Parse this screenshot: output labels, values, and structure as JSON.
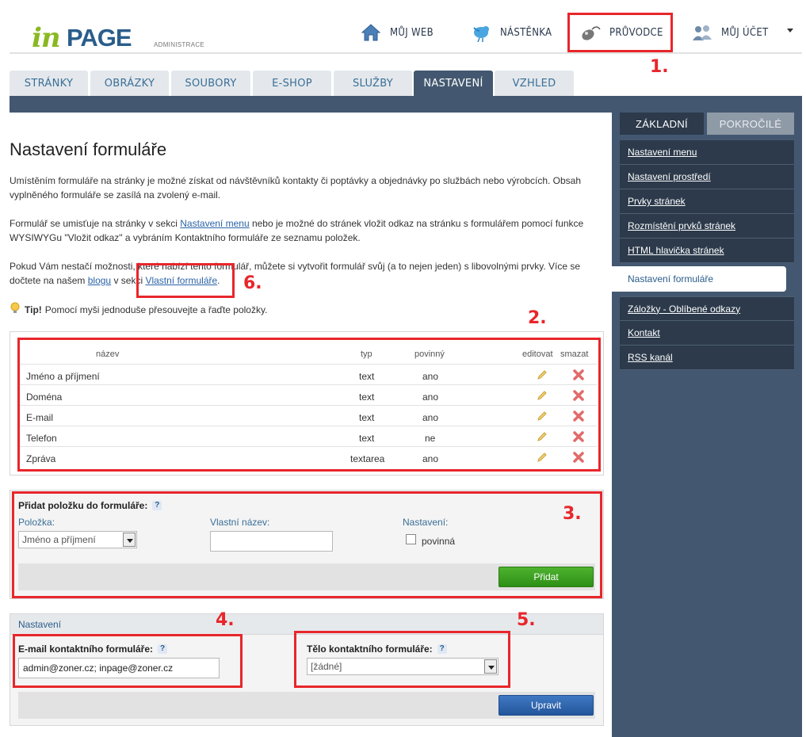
{
  "logo": {
    "part1": "in",
    "part2": "PAGE",
    "sub": "ADMINISTRACE"
  },
  "topnav": [
    {
      "label": "MŮJ WEB",
      "icon": "home-icon"
    },
    {
      "label": "NÁSTĚNKA",
      "icon": "bird-icon"
    },
    {
      "label": "PRŮVODCE",
      "icon": "mouse-icon"
    },
    {
      "label": "MŮJ ÚČET",
      "icon": "users-icon"
    }
  ],
  "tabs": [
    "STRÁNKY",
    "OBRÁZKY",
    "SOUBORY",
    "E-SHOP",
    "SLUŽBY",
    "NASTAVENÍ",
    "VZHLED"
  ],
  "active_tab": "NASTAVENÍ",
  "sidebar": {
    "tabs": [
      "ZÁKLADNÍ",
      "POKROČILÉ"
    ],
    "items": [
      "Nastavení menu",
      "Nastavení prostředí",
      "Prvky stránek",
      "Rozmístění prvků stránek",
      "HTML hlavička stránek",
      "Nastavení formuláře",
      "Záložky - Oblíbené odkazy",
      "Kontakt",
      "RSS kanál"
    ],
    "selected": "Nastavení formuláře"
  },
  "page": {
    "title": "Nastavení formuláře",
    "p1": "Umístěním formuláře na stránky je možné získat od návštěvníků kontakty či poptávky a objednávky po službách nebo výrobcích. Obsah vyplněného formuláře se zasílá na zvolený e-mail.",
    "p2_a": "Formulář se umisťuje na stránky v sekci ",
    "p2_link": "Nastavení menu",
    "p2_b": " nebo je možné do stránek vložit odkaz na stránku s formulářem pomocí funkce WYSIWYGu \"Vložit odkaz\" a vybráním Kontaktního formuláře ze seznamu položek.",
    "p3_a": "Pokud Vám nestačí možnosti, které nabízí tento formulář, můžete si vytvořit formulář svůj (a to nejen jeden) s libovolnými prvky. Více se dočtete na našem ",
    "p3_link1": "blogu",
    "p3_b": " v sekci ",
    "p3_link2": "Vlastní formuláře",
    "p3_c": ".",
    "tip_bold": "Tip!",
    "tip_text": "Pomocí myši jednoduše přesouvejte a řaďte položky."
  },
  "table": {
    "headers": {
      "name": "název",
      "type": "typ",
      "required": "povinný",
      "edit": "editovat",
      "delete": "smazat"
    },
    "rows": [
      {
        "name": "Jméno a příjmení",
        "type": "text",
        "required": "ano"
      },
      {
        "name": "Doména",
        "type": "text",
        "required": "ano"
      },
      {
        "name": "E-mail",
        "type": "text",
        "required": "ano"
      },
      {
        "name": "Telefon",
        "type": "text",
        "required": "ne"
      },
      {
        "name": "Zpráva",
        "type": "textarea",
        "required": "ano"
      }
    ]
  },
  "add_form": {
    "title": "Přidat položku do formuláře:",
    "help": "?",
    "item_label": "Položka:",
    "item_value": "Jméno a příjmení",
    "custom_label": "Vlastní název:",
    "custom_value": "",
    "settings_label": "Nastavení:",
    "required_label": "povinná",
    "add_button": "Přidat"
  },
  "settings": {
    "header": "Nastavení",
    "email_label": "E-mail kontaktního formuláře:",
    "email_value": "admin@zoner.cz; inpage@zoner.cz",
    "body_label": "Tělo kontaktního formuláře:",
    "body_value": "[žádné]",
    "help": "?",
    "update_button": "Upravit"
  },
  "annotations": [
    "1.",
    "2.",
    "3.",
    "4.",
    "5.",
    "6."
  ],
  "colors": {
    "accent_red": "#e8262b",
    "nav_dark": "#435870",
    "sidebar_dark": "#2c3a4b",
    "green": "#3aa022",
    "blue": "#2f66b0"
  }
}
